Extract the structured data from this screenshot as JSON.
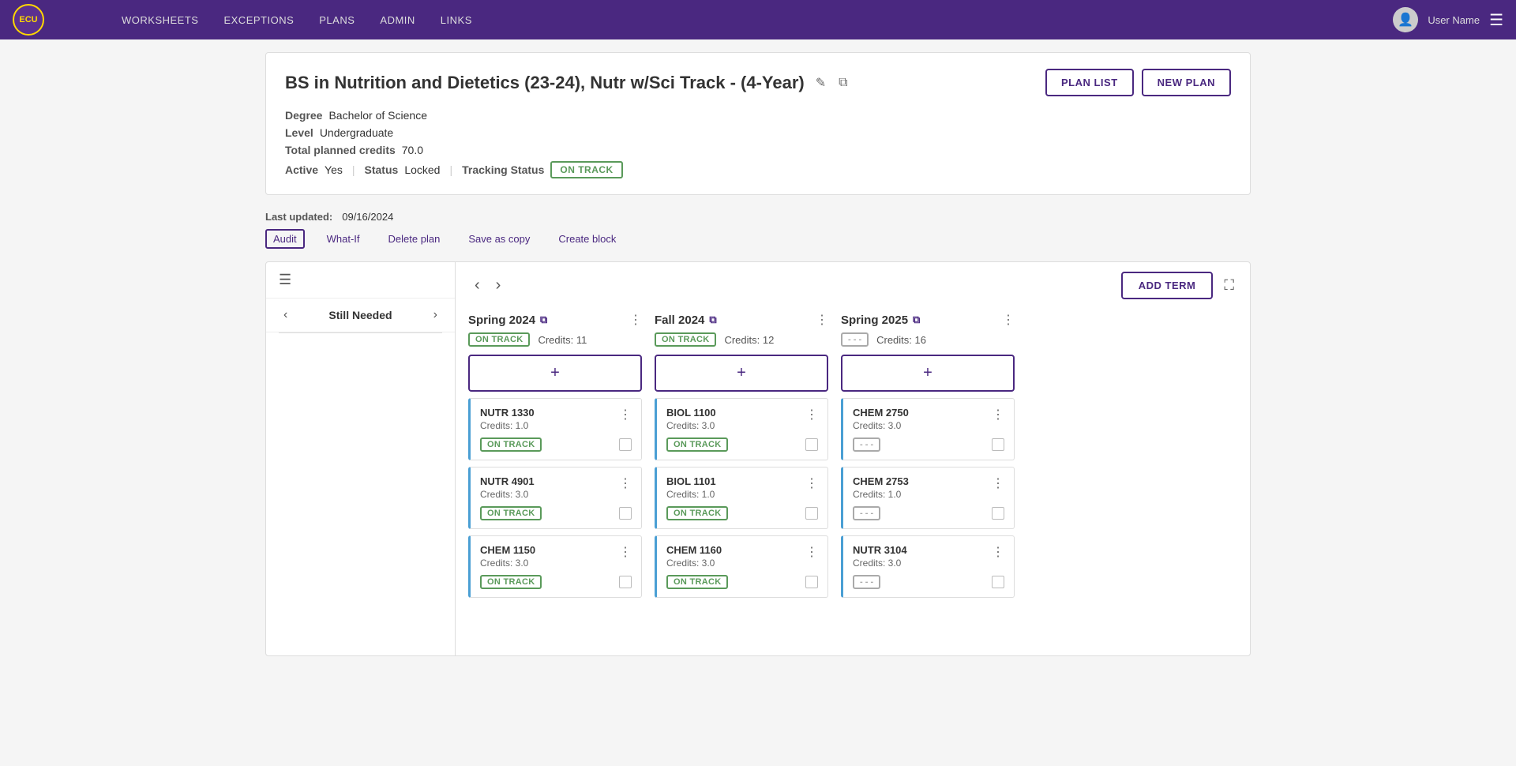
{
  "nav": {
    "logo_text": "ECU",
    "links": [
      "WORKSHEETS",
      "EXCEPTIONS",
      "PLANS",
      "ADMIN",
      "LINKS"
    ],
    "user_name": "User Name",
    "hamburger_label": "☰"
  },
  "plan_header": {
    "title": "BS in Nutrition and Dietetics (23-24), Nutr w/Sci Track - (4-Year)",
    "edit_icon": "✎",
    "copy_icon": "⧉",
    "plan_list_btn": "PLAN LIST",
    "new_plan_btn": "NEW PLAN",
    "degree_label": "Degree",
    "degree_value": "Bachelor of Science",
    "level_label": "Level",
    "level_value": "Undergraduate",
    "credits_label": "Total planned credits",
    "credits_value": "70.0",
    "active_label": "Active",
    "active_value": "Yes",
    "status_label": "Status",
    "status_value": "Locked",
    "tracking_label": "Tracking Status",
    "tracking_badge": "ON TRACK"
  },
  "below_header": {
    "last_updated_label": "Last updated:",
    "last_updated_value": "09/16/2024",
    "links": [
      "Audit",
      "What-If",
      "Delete plan",
      "Save as copy",
      "Create block"
    ]
  },
  "sidebar": {
    "hamburger": "☰",
    "title": "Still Needed",
    "prev_arrow": "‹",
    "next_arrow": "›"
  },
  "columns_toolbar": {
    "prev_btn": "‹",
    "next_btn": "›",
    "add_term_btn": "ADD TERM",
    "expand_icon": "⛶"
  },
  "terms": [
    {
      "id": "spring2024",
      "title": "Spring 2024",
      "copy_icon": "⧉",
      "menu_icon": "⋮",
      "status": "ON TRACK",
      "status_type": "on_track",
      "credits_label": "Credits:",
      "credits_value": "11",
      "courses": [
        {
          "name": "NUTR 1330",
          "credits": "Credits: 1.0",
          "status": "ON TRACK",
          "status_type": "on_track"
        },
        {
          "name": "NUTR 4901",
          "credits": "Credits: 3.0",
          "status": "ON TRACK",
          "status_type": "on_track"
        },
        {
          "name": "CHEM 1150",
          "credits": "Credits: 3.0",
          "status": "ON TRACK",
          "status_type": "on_track"
        }
      ]
    },
    {
      "id": "fall2024",
      "title": "Fall 2024",
      "copy_icon": "⧉",
      "menu_icon": "⋮",
      "status": "ON TRACK",
      "status_type": "on_track",
      "credits_label": "Credits:",
      "credits_value": "12",
      "courses": [
        {
          "name": "BIOL 1100",
          "credits": "Credits: 3.0",
          "status": "ON TRACK",
          "status_type": "on_track"
        },
        {
          "name": "BIOL 1101",
          "credits": "Credits: 1.0",
          "status": "ON TRACK",
          "status_type": "on_track"
        },
        {
          "name": "CHEM 1160",
          "credits": "Credits: 3.0",
          "status": "ON TRACK",
          "status_type": "on_track"
        }
      ]
    },
    {
      "id": "spring2025",
      "title": "Spring 2025",
      "copy_icon": "⧉",
      "menu_icon": "⋮",
      "status": "- - -",
      "status_type": "dashes",
      "credits_label": "Credits:",
      "credits_value": "16",
      "courses": [
        {
          "name": "CHEM 2750",
          "credits": "Credits: 3.0",
          "status": "- - -",
          "status_type": "dashes"
        },
        {
          "name": "CHEM 2753",
          "credits": "Credits: 1.0",
          "status": "- - -",
          "status_type": "dashes"
        },
        {
          "name": "NUTR 3104",
          "credits": "Credits: 3.0",
          "status": "- - -",
          "status_type": "dashes"
        }
      ]
    }
  ],
  "add_course_plus": "+",
  "course_menu_icon": "⋮"
}
